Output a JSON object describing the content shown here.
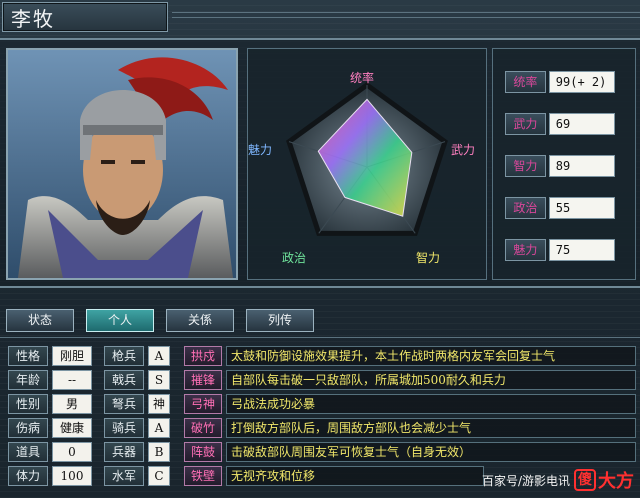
{
  "general": {
    "name": "李牧"
  },
  "radar": {
    "labels": {
      "leadership": "统率",
      "strength": "武力",
      "intelligence": "智力",
      "politics": "政治",
      "charisma": "魅力"
    },
    "values": {
      "leadership": 99,
      "strength": 69,
      "intelligence": 89,
      "politics": 55,
      "charisma": 75
    },
    "max": 120
  },
  "stats": [
    {
      "label": "统率",
      "value": "99(+ 2)"
    },
    {
      "label": "武力",
      "value": "69"
    },
    {
      "label": "智力",
      "value": "89"
    },
    {
      "label": "政治",
      "value": "55"
    },
    {
      "label": "魅力",
      "value": "75"
    }
  ],
  "tabs": [
    {
      "label": "状态",
      "active": false
    },
    {
      "label": "个人",
      "active": true
    },
    {
      "label": "关係",
      "active": false
    },
    {
      "label": "列传",
      "active": false
    }
  ],
  "attributes": [
    {
      "label": "性格",
      "value": "刚胆"
    },
    {
      "label": "年龄",
      "value": "--"
    },
    {
      "label": "性别",
      "value": "男"
    },
    {
      "label": "伤病",
      "value": "健康"
    },
    {
      "label": "道具",
      "value": "0"
    },
    {
      "label": "体力",
      "value": "100"
    }
  ],
  "aptitudes": [
    {
      "label": "枪兵",
      "value": "A"
    },
    {
      "label": "戟兵",
      "value": "S"
    },
    {
      "label": "弩兵",
      "value": "神"
    },
    {
      "label": "骑兵",
      "value": "A"
    },
    {
      "label": "兵器",
      "value": "B"
    },
    {
      "label": "水军",
      "value": "C"
    }
  ],
  "skills": [
    {
      "name": "拱戍",
      "desc": "太鼓和防御设施效果提升，本土作战时两格内友军会回复士气"
    },
    {
      "name": "摧锋",
      "desc": "自部队每击破一只敌部队，所属城加500耐久和兵力"
    },
    {
      "name": "弓神",
      "desc": "弓战法成功必暴"
    },
    {
      "name": "破竹",
      "desc": "打倒敌方部队后，周围敌方部队也会减少士气"
    },
    {
      "name": "阵鼓",
      "desc": "击破敌部队周围友军可恢复士气（自身无效）"
    },
    {
      "name": "铁壁",
      "desc": "无视齐攻和位移"
    }
  ],
  "watermark": {
    "text": "百家号/游影电讯",
    "brand": "大方",
    "logo_char": "傻"
  },
  "colors": {
    "accent": "#d9479a",
    "skill_text": "#f1e76a",
    "active_tab": "#2a8a8e"
  }
}
